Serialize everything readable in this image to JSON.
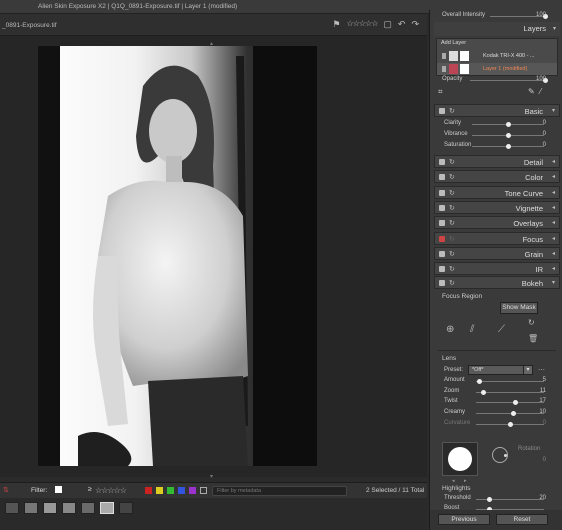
{
  "window": {
    "title": "Alien Skin Exposure X2 | Q1Q_0891-Exposure.tif | Layer 1 (modified)"
  },
  "toolbar": {
    "filename": "_0891-Exposure.tif"
  },
  "filter_bar": {
    "label": "Filter:",
    "rating_prefix": "≥",
    "stars": "☆☆☆☆☆",
    "colors": [
      "#cc2222",
      "#ddcc22",
      "#33bb33",
      "#3355dd",
      "#9933cc"
    ],
    "search_placeholder": "Filter by metadata",
    "count": "2 Selected / 11 Total"
  },
  "panel": {
    "overall_intensity": {
      "label": "Overall Intensity",
      "value": "100",
      "level": 1.0
    },
    "layers": {
      "title": "Layers",
      "add_layer": "Add Layer",
      "items": [
        {
          "name": "Kodak TRI-X 400 - ...",
          "modified": false
        },
        {
          "name": "Layer 1 (modified)",
          "modified": true
        }
      ],
      "opacity": {
        "label": "Opacity",
        "value": "100",
        "level": 1.0
      }
    },
    "basic": {
      "title": "Basic",
      "sliders": [
        {
          "label": "Clarity",
          "value": "0",
          "level": 0.5
        },
        {
          "label": "Vibrance",
          "value": "0",
          "level": 0.5
        },
        {
          "label": "Saturation",
          "value": "0",
          "level": 0.5
        }
      ]
    },
    "sections": [
      "Detail",
      "Color",
      "Tone Curve",
      "Vignette",
      "Overlays",
      "Focus",
      "Grain",
      "IR"
    ],
    "bokeh": {
      "title": "Bokeh",
      "focus_region": "Focus Region",
      "show_mask": "Show Mask",
      "lens": "Lens",
      "preset_label": "Preset:",
      "preset_value": "*Off*",
      "sliders": [
        {
          "label": "Amount",
          "value": "5",
          "level": 0.05
        },
        {
          "label": "Zoom",
          "value": "11",
          "level": 0.11
        },
        {
          "label": "Twist",
          "value": "17",
          "level": 0.58
        },
        {
          "label": "Creamy",
          "value": "10",
          "level": 0.55
        },
        {
          "label": "Curvature",
          "value": "0",
          "level": 0.5
        }
      ],
      "rotation_label": "Rotation",
      "rotation_value": "0"
    },
    "highlights": {
      "title": "Highlights",
      "sliders": [
        {
          "label": "Threshold",
          "value": "20",
          "level": 0.2
        },
        {
          "label": "Boost",
          "value": "",
          "level": 0.2
        }
      ]
    },
    "buttons": {
      "previous": "Previous",
      "reset": "Reset"
    }
  }
}
